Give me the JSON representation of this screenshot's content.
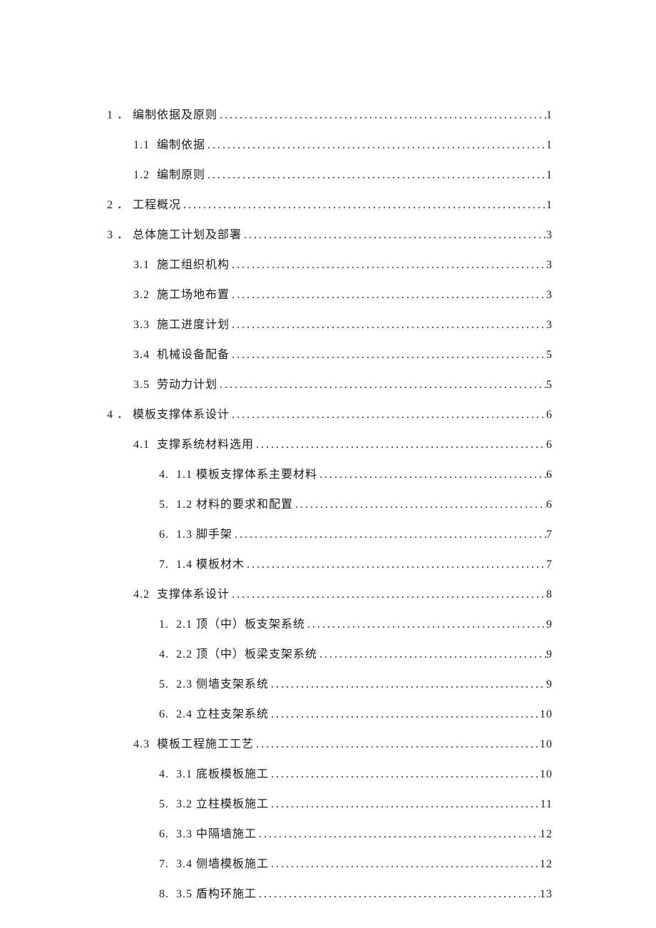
{
  "toc": [
    {
      "level": 1,
      "num": "1",
      "sep": "．",
      "title": "编制依据及原则",
      "page": "1"
    },
    {
      "level": 2,
      "num": "1.1",
      "sep": "",
      "title": "编制依据",
      "page": "1"
    },
    {
      "level": 2,
      "num": "1.2",
      "sep": "",
      "title": "编制原则",
      "page": "1"
    },
    {
      "level": 1,
      "num": "2",
      "sep": "．",
      "title": "工程概况",
      "page": "1"
    },
    {
      "level": 1,
      "num": "3",
      "sep": "．",
      "title": "总体施工计划及部署",
      "page": "3"
    },
    {
      "level": 2,
      "num": "3.1",
      "sep": " ",
      "title": "施工组织机构",
      "page": "3"
    },
    {
      "level": 2,
      "num": "3.2",
      "sep": " ",
      "title": "施工场地布置",
      "page": "3"
    },
    {
      "level": 2,
      "num": "3.3",
      "sep": " ",
      "title": "施工进度计划",
      "page": "3"
    },
    {
      "level": 2,
      "num": "3.4",
      "sep": " ",
      "title": "机械设备配备",
      "page": "5"
    },
    {
      "level": 2,
      "num": "3.5",
      "sep": " ",
      "title": "劳动力计划",
      "page": "5"
    },
    {
      "level": 1,
      "num": "4",
      "sep": "．",
      "title": "模板支撑体系设计",
      "page": "6"
    },
    {
      "level": 2,
      "num": "4.1",
      "sep": " ",
      "title": "支撑系统材料选用",
      "page": "6"
    },
    {
      "level": 3,
      "num": "4.",
      "sep": " ",
      "title": "1.1 模板支撑体系主要材料",
      "page": "6"
    },
    {
      "level": 3,
      "num": "5.",
      "sep": " ",
      "title": "1.2 材料的要求和配置",
      "page": "6"
    },
    {
      "level": 3,
      "num": "6.",
      "sep": " ",
      "title": "1.3 脚手架",
      "page": "7"
    },
    {
      "level": 3,
      "num": "7.",
      "sep": " ",
      "title": "1.4 模板材木",
      "page": "7"
    },
    {
      "level": 2,
      "num": "4.2",
      "sep": " ",
      "title": "支撑体系设计",
      "page": "8"
    },
    {
      "level": 3,
      "num": "1.",
      "sep": " ",
      "title": "2.1 顶（中）板支架系统",
      "page": "9"
    },
    {
      "level": 3,
      "num": "4.",
      "sep": " ",
      "title": "2.2 顶（中）板梁支架系统",
      "page": "9"
    },
    {
      "level": 3,
      "num": "5.",
      "sep": " ",
      "title": "2.3 侧墙支架系统",
      "page": "9"
    },
    {
      "level": 3,
      "num": "6.",
      "sep": " ",
      "title": "2.4 立柱支架系统",
      "page": "10"
    },
    {
      "level": 2,
      "num": "4.3",
      "sep": " ",
      "title": "模板工程施工工艺",
      "page": "10"
    },
    {
      "level": 3,
      "num": "4.",
      "sep": " ",
      "title": "3.1 底板模板施工",
      "page": "10"
    },
    {
      "level": 3,
      "num": "5.",
      "sep": " ",
      "title": "3.2 立柱模板施工",
      "page": "11"
    },
    {
      "level": 3,
      "num": "6.",
      "sep": " ",
      "title": "3.3 中隔墙施工",
      "page": "12"
    },
    {
      "level": 3,
      "num": "7.",
      "sep": " ",
      "title": "3.4 侧墙模板施工",
      "page": "12"
    },
    {
      "level": 3,
      "num": "8.",
      "sep": " ",
      "title": "3.5 盾构环施工",
      "page": "13"
    }
  ]
}
